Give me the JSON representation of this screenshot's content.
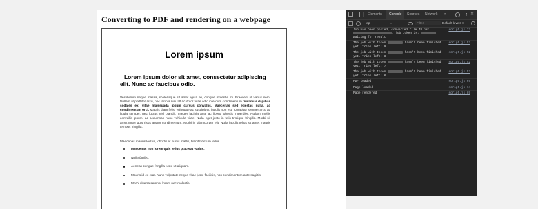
{
  "page": {
    "heading": "Converting to PDF and rendering on a webpage"
  },
  "pdf": {
    "title": "Lorem ipsum",
    "subtitle": "Lorem ipsum dolor sit amet, consectetur adipiscing elit. Nunc ac faucibus odio.",
    "para1_a": "Vestibulum neque massa, scelerisque sit amet ligula eu, congue molestie mi. Praesent ut varius sem. Nullam at porttitor arcu, nec lacinia nisi. Ut ac dolor vitae odio interdum condimentum. ",
    "para1_b": "Vivamus dapibus sodales ex, vitae malesuada ipsum cursus convallis. Maecenas sed egestas nulla, ac condimentum orci.",
    "para1_c": " Mauris diam felis, vulputate ac suscipit et, iaculis non est. Curabitur semper arcu ac ligula semper, nec luctus nisl blandit. Integer lacinia ante ac libero lobortis imperdiet. Nullam mollis convallis ipsum, ac accumsan nunc vehicula vitae. Nulla eget justo in felis tristique fringilla. Morbi sit amet tortor quis risus auctor condimentum. Morbi in ullamcorper elit. Nulla iaculis tellus sit amet mauris tempus fringilla.",
    "para2": "Maecenas mauris lectus, lobortis et purus mattis, blandit dictum tellus.",
    "list": [
      "Maecenas non lorem quis tellus placerat varius.",
      "Nulla facilisi.",
      "Aenean congue fringilla justo ut aliquam.",
      "Mauris id ex erat.",
      " Nunc vulputate neque vitae justo facilisis, non condimentum ante sagittis.",
      "Morbi viverra semper lorem nec molestie."
    ]
  },
  "devtools": {
    "tabs": [
      "Elements",
      "Console",
      "Sources",
      "Network"
    ],
    "active_tab": "Console",
    "more_tabs": "»",
    "close": "✕",
    "context": "top",
    "filter_placeholder": "Filter",
    "levels": "Default levels ▾",
    "logs": [
      {
        "text_a": "Job has been posted, converted file ID is: ",
        "text_b": ", job token is: ",
        "text_c": ", waiting for result",
        "src": "script.js:22"
      },
      {
        "text_a": "The job with token ",
        "text_b": " hasn't been finished yet. Tries left: 9",
        "src": "script.js:52"
      },
      {
        "text_a": "The job with token ",
        "text_b": " hasn't been finished yet. Tries left: 8",
        "src": "script.js:52"
      },
      {
        "text_a": "The job with token ",
        "text_b": " hasn't been finished yet. Tries left: 7",
        "src": "script.js:52"
      },
      {
        "text_a": "The job with token ",
        "text_b": " hasn't been finished yet. Tries left: 6",
        "src": "script.js:52"
      },
      {
        "text_a": "PDF loaded",
        "src": "script.js:69"
      },
      {
        "text_a": "Page loaded",
        "src": "script.js:74"
      },
      {
        "text_a": "Page rendered",
        "src": "script.js:89"
      }
    ],
    "prompt": "›"
  }
}
